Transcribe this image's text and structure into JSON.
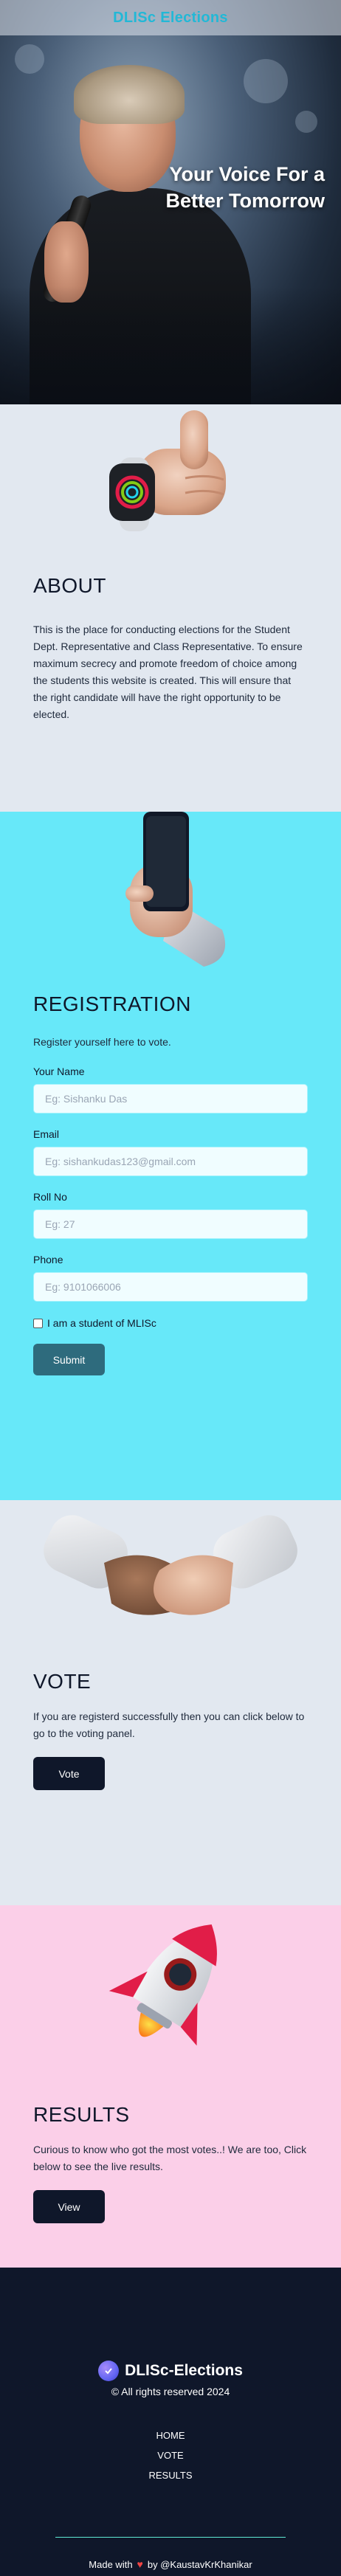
{
  "navbar": {
    "brand": "DLISc Elections"
  },
  "hero": {
    "title_line1": "Your Voice For a",
    "title_line2": "Better Tomorrow"
  },
  "about": {
    "title": "ABOUT",
    "text": "This is the place for conducting elections for the Student Dept. Representative and Class Representative. To ensure maximum secrecy and promote freedom of choice among the students this website is created. This will ensure that the right candidate will have the right opportunity to be elected."
  },
  "registration": {
    "title": "REGISTRATION",
    "lead": "Register yourself here to vote.",
    "fields": [
      {
        "label": "Your Name",
        "placeholder": "Eg: Sishanku Das"
      },
      {
        "label": "Email",
        "placeholder": "Eg: sishankudas123@gmail.com"
      },
      {
        "label": "Roll No",
        "placeholder": "Eg: 27"
      },
      {
        "label": "Phone",
        "placeholder": "Eg: 9101066006"
      }
    ],
    "checkbox_label": "I am a student of MLISc",
    "submit_label": "Submit"
  },
  "vote": {
    "title": "VOTE",
    "text": "If you are registerd successfully then you can click below to go to the voting panel.",
    "button_label": "Vote"
  },
  "results": {
    "title": "RESULTS",
    "text": "Curious to know who got the most votes..! We are too, Click below to see the live results.",
    "button_label": "View"
  },
  "footer": {
    "brand": "DLISc-Elections",
    "copyright": "© All rights reserved 2024",
    "nav": [
      "HOME",
      "VOTE",
      "RESULTS"
    ],
    "made_prefix": "Made with",
    "made_suffix": "by @KaustavKrKhanikar"
  },
  "icons": {
    "about": "thumbs-up-watch-icon",
    "registration": "hand-phone-icon",
    "vote": "handshake-icon",
    "results": "rocket-icon",
    "heart": "heart-icon"
  },
  "colors": {
    "brand": "#22b8d6",
    "registration_bg": "#67e8f9",
    "results_bg": "#fbcfe8",
    "footer_bg": "#0f172a",
    "submit_btn": "#2e6b7d",
    "dark_btn": "#0f172a"
  }
}
